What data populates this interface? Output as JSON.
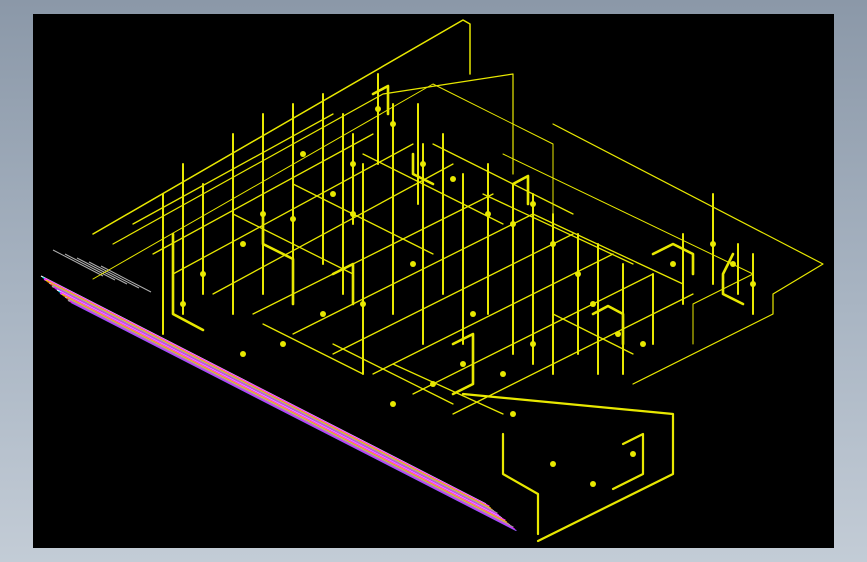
{
  "app": {
    "background": "gradient-gray"
  },
  "viewport": {
    "background_color": "#000000"
  },
  "drawing": {
    "kind": "isometric-piping-wireframe",
    "primary_color": "#e8e800",
    "bundle_colors": [
      "#ffffff",
      "#00e5ff",
      "#ff2bff",
      "#e8e800",
      "#ff7a00",
      "#c0c0c0",
      "#ff3030",
      "#a0a0a0",
      "#ff00ff",
      "#9b59ff"
    ]
  }
}
